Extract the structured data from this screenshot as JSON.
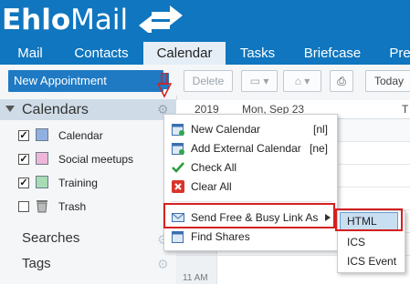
{
  "app": {
    "logo_bold": "Ehlo",
    "logo_rest": "Mail"
  },
  "tabs": [
    {
      "label": "Mail"
    },
    {
      "label": "Contacts"
    },
    {
      "label": "Calendar"
    },
    {
      "label": "Tasks"
    },
    {
      "label": "Briefcase"
    },
    {
      "label": "Pre"
    }
  ],
  "sidebar": {
    "new_appointment": "New Appointment",
    "calendars_header": "Calendars",
    "calendars": [
      {
        "label": "Calendar",
        "checked": true,
        "color": "#8fb0e0",
        "icon": "calendar-icon"
      },
      {
        "label": "Social meetups",
        "checked": true,
        "color": "#f0b6d8",
        "icon": "calendar-icon"
      },
      {
        "label": "Training",
        "checked": true,
        "color": "#a8dcb4",
        "icon": "calendar-icon"
      },
      {
        "label": "Trash",
        "checked": false,
        "icon": "trash-icon"
      }
    ],
    "searches": "Searches",
    "tags": "Tags"
  },
  "toolbar": {
    "delete": "Delete",
    "today": "Today"
  },
  "calendar_view": {
    "year": "2019",
    "day1": "Mon, Sep 23",
    "day2": "T",
    "time_label": "11 AM"
  },
  "context_menu": {
    "items": [
      {
        "label": "New Calendar",
        "shortcut": "[nl]",
        "icon": "new-calendar-icon"
      },
      {
        "label": "Add External Calendar",
        "shortcut": "[ne]",
        "icon": "external-calendar-icon"
      },
      {
        "label": "Check All",
        "shortcut": "",
        "icon": "checkmark-icon"
      },
      {
        "label": "Clear All",
        "shortcut": "",
        "icon": "clear-icon"
      },
      {
        "label": "Send Free & Busy Link As",
        "shortcut": "",
        "icon": "envelope-icon"
      },
      {
        "label": "Find Shares",
        "shortcut": "",
        "icon": "find-shares-icon"
      }
    ]
  },
  "submenu": {
    "items": [
      {
        "label": "HTML"
      },
      {
        "label": "ICS"
      },
      {
        "label": "ICS Event"
      }
    ]
  },
  "colors": {
    "header_blue": "#0f76bf",
    "button_blue": "#1f7ac3",
    "highlight_red": "#d42020"
  }
}
